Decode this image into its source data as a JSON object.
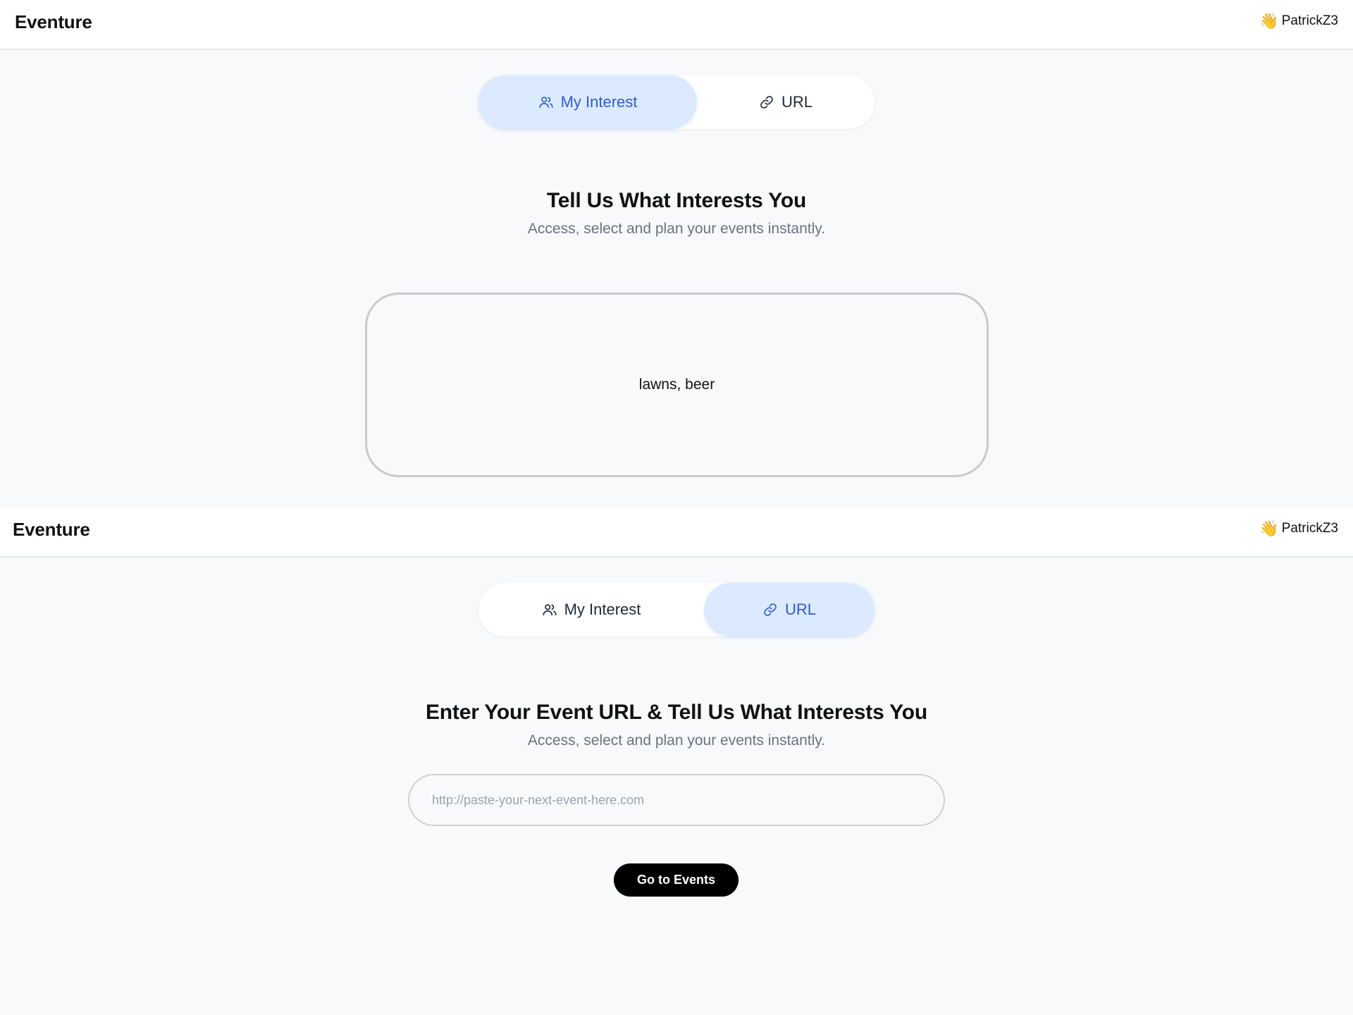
{
  "app": {
    "brand": "Eventure",
    "username": "PatrickZ3",
    "user_icon": "waving-hand-icon"
  },
  "colors": {
    "active_tab_bg": "#dbeafe",
    "active_tab_text": "#2f5bd3",
    "page_bg": "#f8f9fb",
    "button_bg": "#000000"
  },
  "tabs": {
    "interest_label": "My Interest",
    "interest_icon": "users-icon",
    "url_label": "URL",
    "url_icon": "link-icon"
  },
  "interest_view": {
    "active_tab": "My Interest",
    "title": "Tell Us What Interests You",
    "subtitle": "Access, select and plan your events instantly.",
    "interest_value": "lawns, beer"
  },
  "url_view": {
    "active_tab": "URL",
    "title": "Enter Your Event URL & Tell Us What Interests You",
    "subtitle": "Access, select and plan your events instantly.",
    "url_placeholder": "http://paste-your-next-event-here.com",
    "url_value": "",
    "go_button": "Go to Events"
  }
}
